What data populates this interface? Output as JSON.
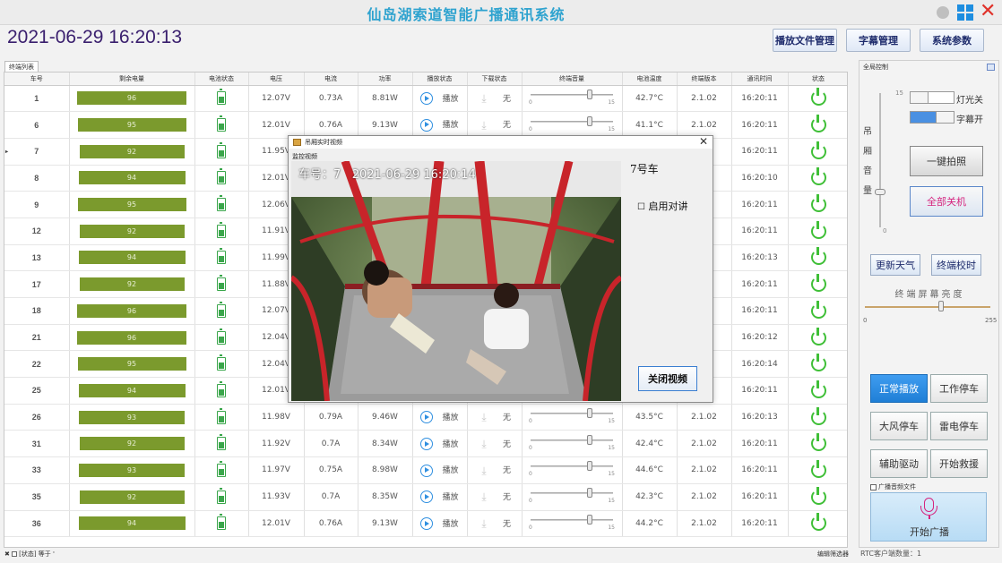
{
  "app": {
    "title": "仙岛湖索道智能广播通讯系统"
  },
  "header": {
    "datetime": "2021-06-29 16:20:13"
  },
  "toolbar": {
    "file_mgmt": "播放文件管理",
    "subtitle_mgmt": "字幕管理",
    "sys_params": "系统参数"
  },
  "tabs": {
    "terminal_list": "终端列表"
  },
  "grid": {
    "headers": [
      "车号",
      "剩余电量",
      "电池状态",
      "电压",
      "电流",
      "功率",
      "播放状态",
      "下载状态",
      "终端音量",
      "电池温度",
      "终端版本",
      "通讯时间",
      "状态"
    ],
    "volume_min": "0",
    "volume_max": "15",
    "rows": [
      {
        "car": "1",
        "charge": "96",
        "voltage": "12.07V",
        "current": "0.73A",
        "power": "8.81W",
        "play": "播放",
        "download": "无",
        "volume": 11,
        "temp": "42.7°C",
        "version": "2.1.02",
        "time": "16:20:11"
      },
      {
        "car": "6",
        "charge": "95",
        "voltage": "12.01V",
        "current": "0.76A",
        "power": "9.13W",
        "play": "播放",
        "download": "无",
        "volume": 11,
        "temp": "41.1°C",
        "version": "2.1.02",
        "time": "16:20:11"
      },
      {
        "car": "7",
        "charge": "92",
        "voltage": "11.95V",
        "current": "",
        "power": "",
        "play": "",
        "download": "",
        "volume": null,
        "temp": "",
        "version": "",
        "time": "16:20:11"
      },
      {
        "car": "8",
        "charge": "94",
        "voltage": "12.01V",
        "current": "",
        "power": "",
        "play": "",
        "download": "",
        "volume": null,
        "temp": "",
        "version": "",
        "time": "16:20:10"
      },
      {
        "car": "9",
        "charge": "95",
        "voltage": "12.06V",
        "current": "",
        "power": "",
        "play": "",
        "download": "",
        "volume": null,
        "temp": "",
        "version": "",
        "time": "16:20:11"
      },
      {
        "car": "12",
        "charge": "92",
        "voltage": "11.91V",
        "current": "",
        "power": "",
        "play": "",
        "download": "",
        "volume": null,
        "temp": "",
        "version": "",
        "time": "16:20:11"
      },
      {
        "car": "13",
        "charge": "94",
        "voltage": "11.99V",
        "current": "",
        "power": "",
        "play": "",
        "download": "",
        "volume": null,
        "temp": "",
        "version": "",
        "time": "16:20:13"
      },
      {
        "car": "17",
        "charge": "92",
        "voltage": "11.88V",
        "current": "",
        "power": "",
        "play": "",
        "download": "",
        "volume": null,
        "temp": "",
        "version": "",
        "time": "16:20:11"
      },
      {
        "car": "18",
        "charge": "96",
        "voltage": "12.07V",
        "current": "",
        "power": "",
        "play": "",
        "download": "",
        "volume": null,
        "temp": "",
        "version": "",
        "time": "16:20:11"
      },
      {
        "car": "21",
        "charge": "96",
        "voltage": "12.04V",
        "current": "",
        "power": "",
        "play": "",
        "download": "",
        "volume": null,
        "temp": "",
        "version": "",
        "time": "16:20:12"
      },
      {
        "car": "22",
        "charge": "95",
        "voltage": "12.04V",
        "current": "",
        "power": "",
        "play": "",
        "download": "",
        "volume": null,
        "temp": "",
        "version": "",
        "time": "16:20:14"
      },
      {
        "car": "25",
        "charge": "94",
        "voltage": "12.01V",
        "current": "",
        "power": "",
        "play": "",
        "download": "",
        "volume": null,
        "temp": "",
        "version": "",
        "time": "16:20:11"
      },
      {
        "car": "26",
        "charge": "93",
        "voltage": "11.98V",
        "current": "0.79A",
        "power": "9.46W",
        "play": "播放",
        "download": "无",
        "volume": 11,
        "temp": "43.5°C",
        "version": "2.1.02",
        "time": "16:20:13"
      },
      {
        "car": "31",
        "charge": "92",
        "voltage": "11.92V",
        "current": "0.7A",
        "power": "8.34W",
        "play": "播放",
        "download": "无",
        "volume": 11,
        "temp": "42.4°C",
        "version": "2.1.02",
        "time": "16:20:11"
      },
      {
        "car": "33",
        "charge": "93",
        "voltage": "11.97V",
        "current": "0.75A",
        "power": "8.98W",
        "play": "播放",
        "download": "无",
        "volume": 11,
        "temp": "44.6°C",
        "version": "2.1.02",
        "time": "16:20:11"
      },
      {
        "car": "35",
        "charge": "92",
        "voltage": "11.93V",
        "current": "0.7A",
        "power": "8.35W",
        "play": "播放",
        "download": "无",
        "volume": 11,
        "temp": "42.3°C",
        "version": "2.1.02",
        "time": "16:20:11"
      },
      {
        "car": "36",
        "charge": "94",
        "voltage": "12.01V",
        "current": "0.76A",
        "power": "9.13W",
        "play": "播放",
        "download": "无",
        "volume": 11,
        "temp": "44.2°C",
        "version": "2.1.02",
        "time": "16:20:11"
      }
    ]
  },
  "footer": {
    "status_filter": "[状态] 等于 '",
    "edit_filter": "编辑筛选器",
    "rtc_clients": "RTC客户端数量：1"
  },
  "panel": {
    "title": "全局控制",
    "vol_label": [
      "吊",
      "厢",
      "音",
      "量"
    ],
    "vol_max": "15",
    "vol_min": "0",
    "vol_value": 4,
    "light": "灯光关",
    "subtitle": "字幕开",
    "snapshot": "一键拍照",
    "shutdown": "全部关机",
    "weather": "更新天气",
    "timesync": "终端校时",
    "brightness": "终端屏幕亮度",
    "bright_min": "0",
    "bright_max": "255",
    "bright_value": 155,
    "normal": "正常播放",
    "work_stop": "工作停车",
    "wind_stop": "大风停车",
    "thunder_stop": "雷电停车",
    "aux_drive": "辅助驱动",
    "rescue": "开始救援",
    "bcast_file": "广播音频文件",
    "start_bcast": "开始广播"
  },
  "dialog": {
    "title": "吊厢实时视频",
    "menu": "监控视频",
    "osd_car": "车号：7",
    "osd_time": "2021-06-29 16:20:14",
    "car_label": "7号车",
    "intercom": "启用对讲",
    "close": "关闭视频"
  },
  "colors": {
    "title": "#2fa3cf",
    "datetime": "#3a1f6e",
    "charge_bar": "#7b9a2d",
    "ok": "#3fbf37",
    "accent": "#1f7fd6",
    "pink": "#d6247e"
  }
}
